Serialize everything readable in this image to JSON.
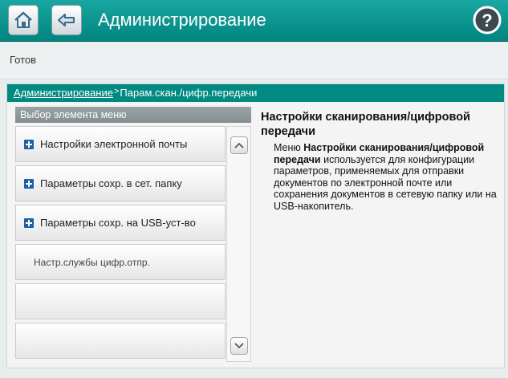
{
  "header": {
    "title": "Администрирование",
    "icons": {
      "home": "home-icon",
      "back": "back-icon",
      "help": "help-icon"
    }
  },
  "status": {
    "text": "Готов"
  },
  "breadcrumb": {
    "root": "Администрирование",
    "separator": ">",
    "current": "Парам.скан./цифр.передачи"
  },
  "menu": {
    "header": "Выбор элемента меню",
    "items": [
      {
        "label": "Настройки электронной почты",
        "expandable": true
      },
      {
        "label": "Параметры сохр. в сет. папку",
        "expandable": true
      },
      {
        "label": "Параметры сохр. на USB-уст-во",
        "expandable": true
      },
      {
        "label": "Настр.службы цифр.отпр.",
        "expandable": false
      },
      {
        "label": "",
        "expandable": false
      },
      {
        "label": "",
        "expandable": false
      }
    ]
  },
  "description": {
    "title": "Настройки сканирования/цифровой передачи",
    "body_prefix": "Меню ",
    "body_bold": "Настройки сканирования/цифровой передачи",
    "body_suffix": " используется для конфигурации параметров, применяемых для отправки документов по электронной почте или сохранения документов в сетевую папку или на USB-накопитель."
  },
  "colors": {
    "accent": "#00857f",
    "menu_header": "#8c9698",
    "plus_icon": "#1d5fa8"
  }
}
